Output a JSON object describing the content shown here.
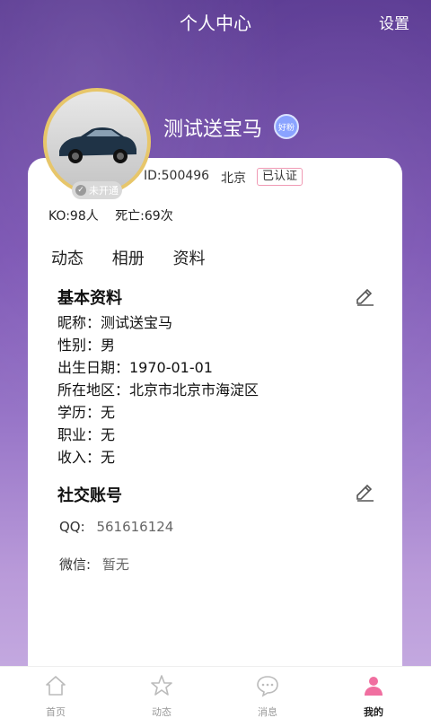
{
  "header": {
    "title": "个人中心",
    "settings_label": "设置"
  },
  "profile": {
    "nickname": "测试送宝马",
    "bind_badge": "未开通",
    "level_badge": "好粉",
    "id_text": "ID:500496",
    "city": "北京",
    "verified_label": "已认证",
    "ko_text": "KO:98人",
    "death_text": "死亡:69次"
  },
  "tabs": [
    "动态",
    "相册",
    "资料"
  ],
  "basic_info": {
    "title": "基本资料",
    "rows": [
      "昵称：测试送宝马",
      "性别：男",
      "出生日期：1970-01-01",
      "所在地区：北京市北京市海淀区",
      "学历：无",
      "职业：无",
      "收入：无"
    ]
  },
  "social": {
    "title": "社交账号",
    "qq_label": "QQ:",
    "qq_value": "561616124",
    "wechat_label": "微信:",
    "wechat_value": "暂无"
  },
  "bottom_nav": [
    {
      "label": "首页",
      "icon": "home-icon"
    },
    {
      "label": "动态",
      "icon": "star-icon"
    },
    {
      "label": "消息",
      "icon": "chat-bubble-icon"
    },
    {
      "label": "我的",
      "icon": "person-icon"
    }
  ],
  "colors": {
    "accent_pink": "#f06fa0",
    "verified_border": "#f09ab4",
    "avatar_border": "#e7c66a"
  }
}
